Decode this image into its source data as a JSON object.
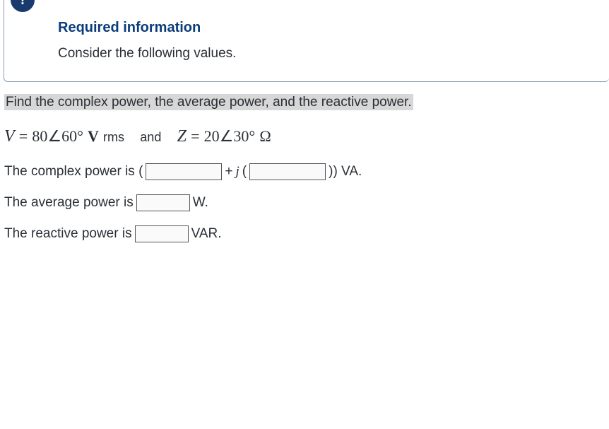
{
  "info_box": {
    "badge_icon": "!",
    "title": "Required information",
    "subtitle": "Consider the following values."
  },
  "question": {
    "prompt": "Find the complex power, the average power, and the reactive power.",
    "equation": {
      "var1": "V",
      "eq1": "=",
      "val1": "80",
      "angle_sym1": "∠",
      "ang1": "60",
      "deg1": "°",
      "unit1_v": "V",
      "unit1_rms": "rms",
      "and": "and",
      "var2": "Z",
      "eq2": "=",
      "val2": "20",
      "angle_sym2": "∠",
      "ang2": "30",
      "deg2": "°",
      "unit2": "Ω"
    },
    "lines": {
      "complex_power_pre": "The complex power is (",
      "complex_power_mid": "+",
      "complex_power_j": "j",
      "complex_power_paren": "(",
      "complex_power_post": ")) VA.",
      "average_power_pre": "The average power is",
      "average_power_unit": "W.",
      "reactive_power_pre": "The reactive power is",
      "reactive_power_unit": "VAR."
    }
  }
}
